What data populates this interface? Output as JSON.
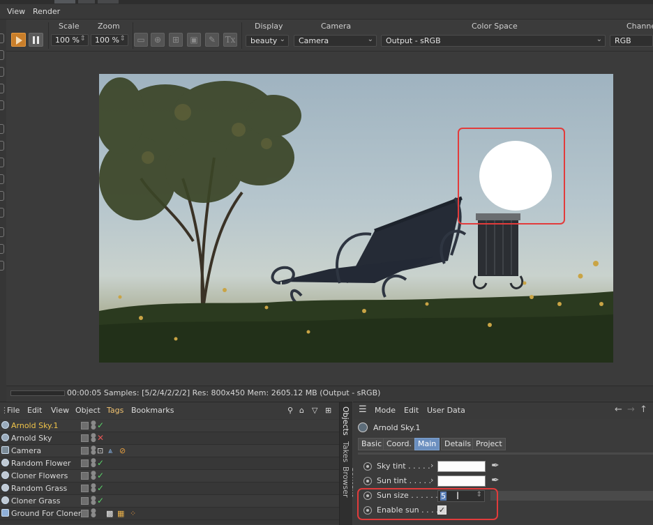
{
  "menubar": {
    "view": "View",
    "render": "Render"
  },
  "toolbar": {
    "scale_label": "Scale",
    "scale_value": "100 %",
    "zoom_label": "Zoom",
    "zoom_value": "100 %",
    "tx_label": "Tx",
    "display_label": "Display",
    "display_value": "beauty",
    "camera_label": "Camera",
    "camera_value": "Camera",
    "colorspace_label": "Color Space",
    "colorspace_value": "Output - sRGB",
    "channel_label": "Channe",
    "channel_value": "RGB"
  },
  "status": {
    "text": "00:00:05  Samples: [5/2/4/2/2/2]  Res: 800x450  Mem: 2605.12 MB  (Output - sRGB)"
  },
  "objects_menu": {
    "file": "File",
    "edit": "Edit",
    "view": "View",
    "object": "Object",
    "tags": "Tags",
    "bookmarks": "Bookmarks"
  },
  "side_tabs": {
    "objects": "Objects",
    "takes": "Takes",
    "content_browser": "Content Browser"
  },
  "objects": [
    {
      "name": "Arnold Sky.1",
      "status": "✓",
      "status_color": "#5bd36a",
      "selected": true
    },
    {
      "name": "Arnold Sky",
      "status": "✕",
      "status_color": "#e05656",
      "selected": false
    },
    {
      "name": "Camera",
      "status": "",
      "status_color": "",
      "selected": false
    },
    {
      "name": "Random Flower",
      "status": "✓",
      "status_color": "#5bd36a",
      "selected": false
    },
    {
      "name": "Cloner Flowers",
      "status": "✓",
      "status_color": "#5bd36a",
      "selected": false
    },
    {
      "name": "Random Grass",
      "status": "✓",
      "status_color": "#5bd36a",
      "selected": false
    },
    {
      "name": "Cloner Grass",
      "status": "✓",
      "status_color": "#5bd36a",
      "selected": false
    },
    {
      "name": "Ground For Cloner",
      "status": "",
      "status_color": "",
      "selected": false
    }
  ],
  "attributes": {
    "menu": {
      "mode": "Mode",
      "edit": "Edit",
      "user_data": "User Data"
    },
    "object_name": "Arnold Sky.1",
    "tabs": {
      "basic": "Basic",
      "coord": "Coord.",
      "main": "Main",
      "details": "Details",
      "project": "Project"
    },
    "active_tab": "Main",
    "params": {
      "sky_tint": "Sky tint . . . . .",
      "sun_tint": "Sun tint . . . . .",
      "sun_size": "Sun size . . . . . .",
      "sun_size_value": "5",
      "enable_sun": "Enable sun . . . .",
      "enable_sun_value": "✓"
    }
  },
  "colors": {
    "accent_orange": "#c97e2a",
    "selection_yellow": "#f0c44a",
    "highlight_red": "#e23b3b",
    "active_tab": "#6b8fbf"
  }
}
